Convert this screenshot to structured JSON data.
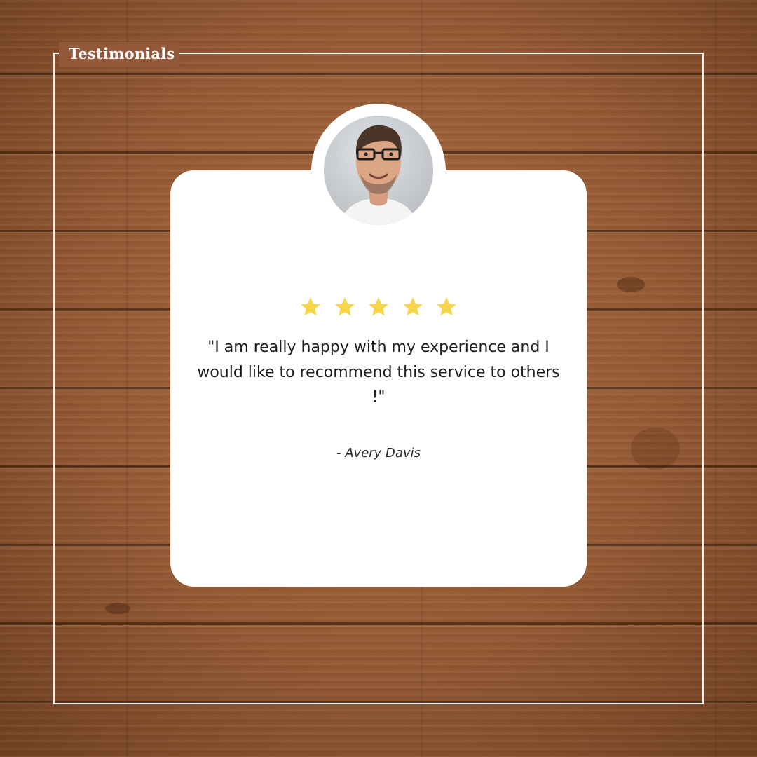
{
  "header": {
    "title": "Testimonials"
  },
  "testimonial": {
    "rating": {
      "value": 5,
      "max": 5,
      "star_color": "#f7d64a"
    },
    "quote": "\"I am really happy with my experience and I would like to recommend this service to others !\"",
    "author": "- Avery Davis"
  },
  "colors": {
    "background": "#935a35",
    "card": "#ffffff",
    "frame": "#ffffff"
  }
}
